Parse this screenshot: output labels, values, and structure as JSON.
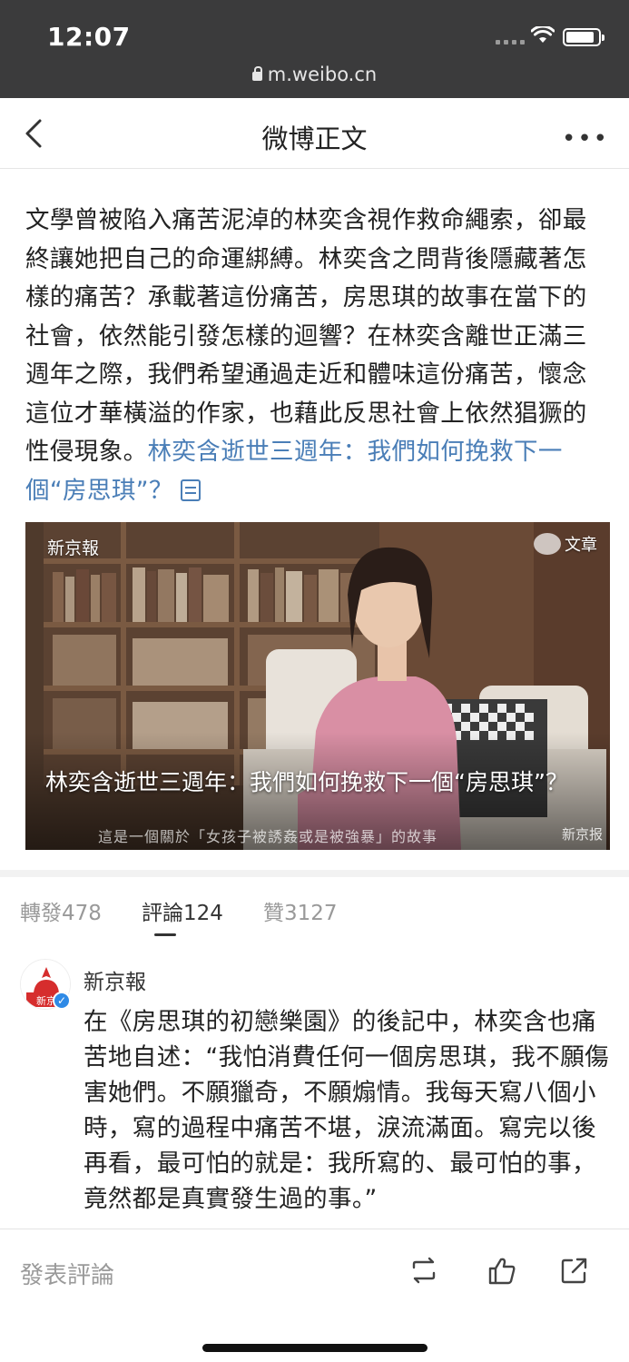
{
  "status_bar": {
    "time": "12:07",
    "url": "m.weibo.cn"
  },
  "nav": {
    "title": "微博正文"
  },
  "post": {
    "text": "文學曾被陷入痛苦泥淖的林奕含視作救命繩索，卻最終讓她把自己的命運綁縛。林奕含之問背後隱藏著怎樣的痛苦？承載著這份痛苦，房思琪的故事在當下的社會，依然能引發怎樣的迴響？在林奕含離世正滿三週年之際，我們希望通過走近和體味這份痛苦，懷念這位才華橫溢的作家，也藉此反思社會上依然猖獗的性侵現象。",
    "link_text": "林奕含逝世三週年：我們如何挽救下一個“房思琪”？",
    "link_icon": "document-icon"
  },
  "article_card": {
    "source": "新京報",
    "badge": "文章",
    "title": "林奕含逝世三週年：我們如何挽救下一個“房思琪”？",
    "subtitle_overlay": "這是一個關於「女孩子被誘姦或是被強暴」的故事",
    "watermark": "新京报"
  },
  "tabs": [
    {
      "label": "轉發478",
      "active": false
    },
    {
      "label": "評論124",
      "active": true
    },
    {
      "label": "贊3127",
      "active": false
    }
  ],
  "comment": {
    "author": "新京報",
    "avatar_text": "新京",
    "text": "在《房思琪的初戀樂園》的後記中，林奕含也痛苦地自述：“我怕消費任何一個房思琪，我不願傷害她們。不願獵奇，不願煽情。我每天寫八個小時，寫的過程中痛苦不堪，淚流滿面。寫完以後再看，最可怕的就是：我所寫的、最可怕的事，竟然都是真實發生過的事。”"
  },
  "bottom_bar": {
    "placeholder": "發表評論",
    "icons": [
      "repost-icon",
      "like-icon",
      "share-icon"
    ]
  },
  "colors": {
    "status_bar_bg": "#3b3b3c",
    "link": "#4a7eb7",
    "muted": "#999999"
  }
}
